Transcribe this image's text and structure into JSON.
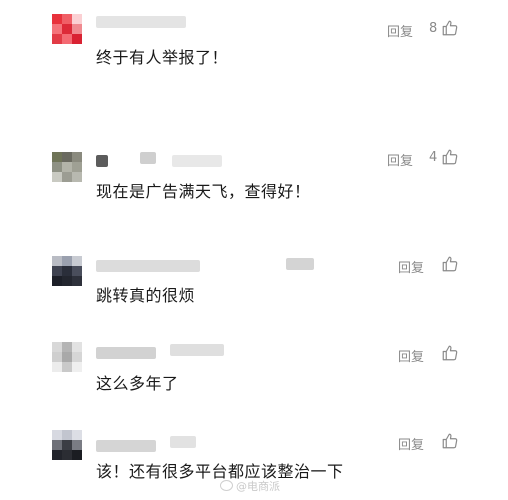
{
  "comments": [
    {
      "text": "终于有人举报了！",
      "reply_label": "回复",
      "likes": "8"
    },
    {
      "text": "现在是广告满天飞，查得好！",
      "reply_label": "回复",
      "likes": "4"
    },
    {
      "text": "跳转真的很烦",
      "reply_label": "回复",
      "likes": ""
    },
    {
      "text": "这么多年了",
      "reply_label": "回复",
      "likes": ""
    },
    {
      "text": "该！还有很多平台都应该整治一下",
      "reply_label": "回复",
      "likes": ""
    }
  ],
  "watermark": {
    "text": "@电商派"
  },
  "icons": {
    "like": "thumbs-up-icon",
    "watermark": "weibo-logo-icon"
  }
}
